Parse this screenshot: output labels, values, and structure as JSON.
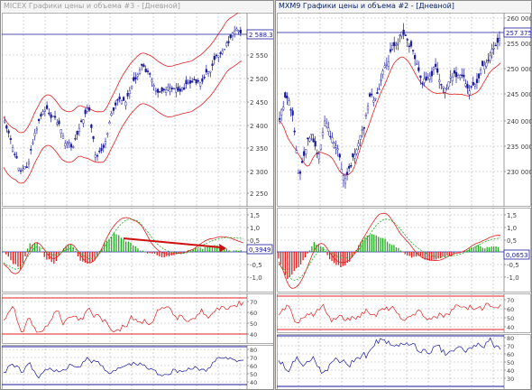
{
  "colors": {
    "candle": "#1a1a9a",
    "band": "#e02020",
    "signal": "#22aa22",
    "hist_pos": "#22aa22",
    "hist_neg": "#e02020",
    "ref": "#2020a0",
    "grid": "#b4b4b4",
    "arrow": "#d01010",
    "blue_line": "#1a1a9a"
  },
  "left_window": {
    "title": "MICEX Графики цены и объема #3 - [Дневной]",
    "price": {
      "ticks": [
        "2 550",
        "2 500",
        "2 450",
        "2 400",
        "2 350",
        "2 300",
        "2 250"
      ],
      "badge": "2 588.30"
    },
    "macd": {
      "ticks": [
        "1,5",
        "1,0",
        "0,5",
        "-0,5",
        "-1,0"
      ],
      "badge": "0,3949"
    },
    "osc1": {
      "ticks": [
        "70",
        "60",
        "50",
        "40"
      ]
    },
    "osc2": {
      "ticks": [
        "80",
        "70",
        "60",
        "50",
        "40"
      ]
    }
  },
  "right_window": {
    "title": "MXM9 Графики цены и объема #2 - [Дневной]",
    "price": {
      "ticks": [
        "260 000",
        "255 000",
        "250 000",
        "245 000",
        "240 000",
        "235 000",
        "230 000"
      ],
      "badge": "257 375"
    },
    "macd": {
      "ticks": [
        "1,5",
        "1,0",
        "0,5",
        "-0,5",
        "-1,0"
      ],
      "badge": "0,0653"
    },
    "osc1": {
      "ticks": [
        "70",
        "60",
        "50",
        "40"
      ]
    },
    "osc2": {
      "ticks": [
        "80",
        "70",
        "60",
        "50",
        "40",
        "30"
      ]
    }
  },
  "icons": {
    "annotation_arrow": "arrow-right-icon"
  }
}
